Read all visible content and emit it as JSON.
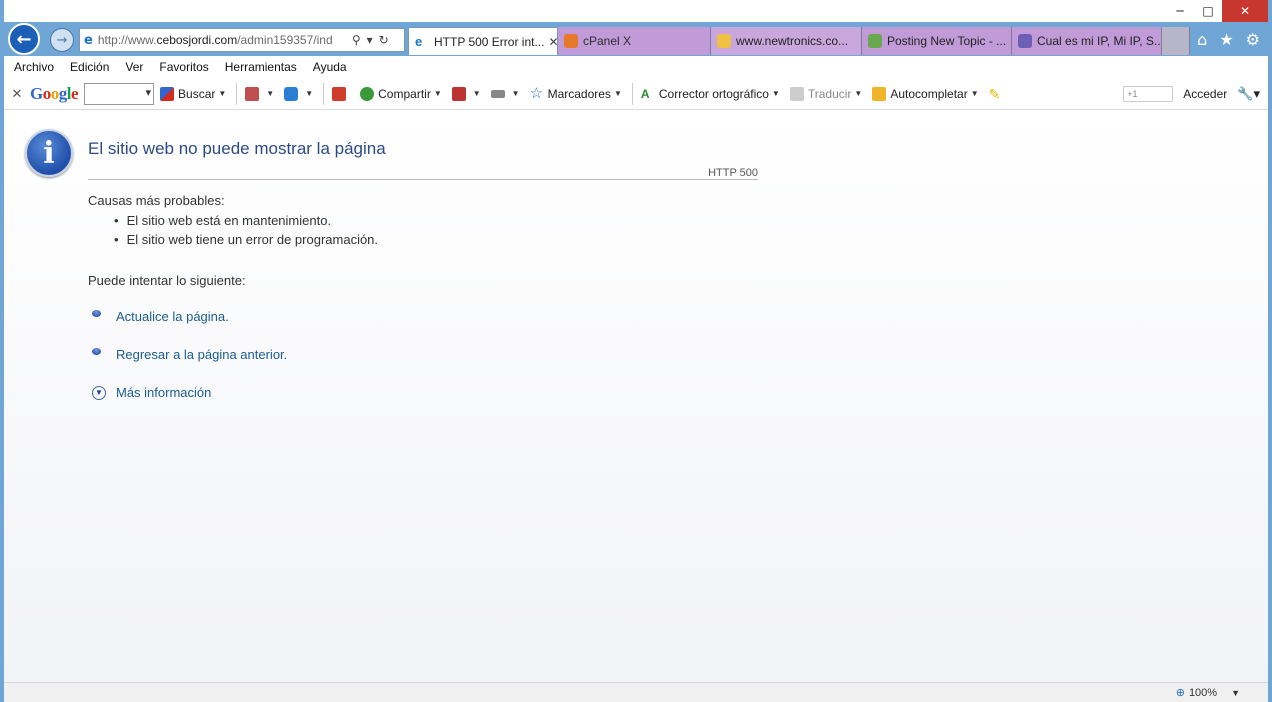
{
  "window_controls": {
    "minimize": "─",
    "maximize": "□",
    "close": "✕"
  },
  "address": {
    "prefix": "http://www.",
    "domain": "cebosjordi.com",
    "path": "/admin159357/ind"
  },
  "tabs": [
    {
      "label": "HTTP 500 Error int...",
      "active": true,
      "color": "#ffffff"
    },
    {
      "label": "cPanel X",
      "color": "#c19ad8"
    },
    {
      "label": "www.newtronics.co...",
      "color": "#c9a6dc"
    },
    {
      "label": "Posting New Topic - ...",
      "color": "#c19ad8"
    },
    {
      "label": "Cual es mi IP, Mi IP, S...",
      "color": "#c19ad8"
    }
  ],
  "menu": [
    "Archivo",
    "Edición",
    "Ver",
    "Favoritos",
    "Herramientas",
    "Ayuda"
  ],
  "google_toolbar": {
    "search_label": "Buscar",
    "share_label": "Compartir",
    "bookmarks_label": "Marcadores",
    "spellcheck_label": "Corrector ortográfico",
    "translate_label": "Traducir",
    "autofill_label": "Autocompletar",
    "plus_one": "+1",
    "signin_label": "Acceder"
  },
  "page": {
    "title": "El sitio web no puede mostrar la página",
    "code": "HTTP 500",
    "causes_heading": "Causas más probables:",
    "causes": [
      "El sitio web está en mantenimiento.",
      "El sitio web tiene un error de programación."
    ],
    "try_heading": "Puede intentar lo siguiente:",
    "refresh_link": "Actualice la página.",
    "back_link": "Regresar a la página anterior.",
    "more_info": "Más información"
  },
  "status": {
    "zoom": "100%"
  },
  "colors": {
    "frame": "#6fa6d6",
    "link": "#1b5d8f",
    "title": "#2c4a86"
  }
}
